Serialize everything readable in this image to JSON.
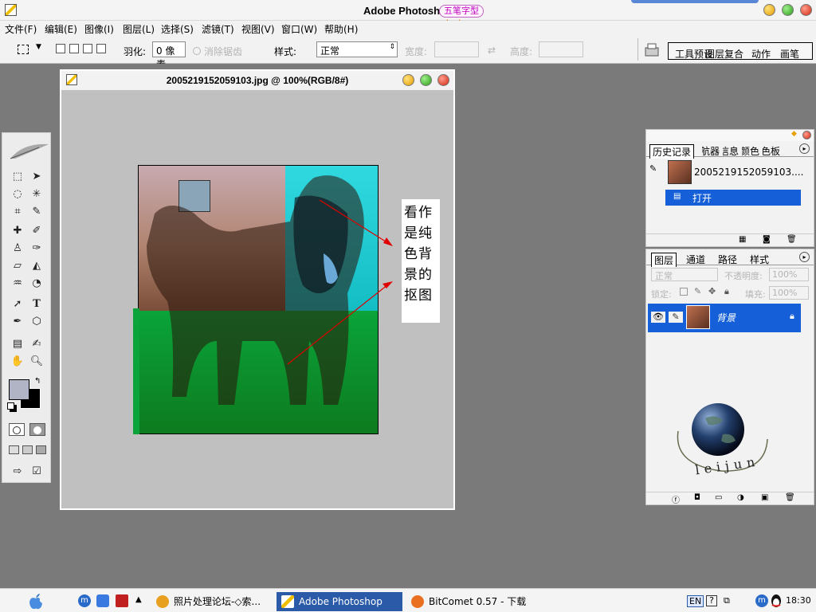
{
  "app": {
    "title": "Adobe Photoshop",
    "ime_badge": "五笔字型"
  },
  "menubar": [
    "文件(F)",
    "编辑(E)",
    "图像(I)",
    "图层(L)",
    "选择(S)",
    "滤镜(T)",
    "视图(V)",
    "窗口(W)",
    "帮助(H)"
  ],
  "options": {
    "feather_label": "羽化:",
    "feather_value": "0 像素",
    "antialias_label": "消除锯齿",
    "style_label": "样式:",
    "style_value": "正常",
    "width_label": "宽度:",
    "height_label": "高度:"
  },
  "palette_well": [
    "工具预设",
    "图层复合",
    "动作",
    "画笔"
  ],
  "document": {
    "title": "2005219152059103.jpg @ 100%(RGB/8#)",
    "annotation": [
      "看作",
      "是纯",
      "色背",
      "景的",
      "抠图"
    ]
  },
  "history_panel": {
    "tabs": [
      "历史记录",
      "导航器",
      "信息",
      "颜色",
      "色板"
    ],
    "snapshot_name": "2005219152059103....",
    "step": "打开"
  },
  "layers_panel": {
    "tabs": [
      "图层",
      "通道",
      "路径",
      "样式"
    ],
    "blend_mode": "正常",
    "opacity_label": "不透明度:",
    "opacity_value": "100%",
    "lock_label": "锁定:",
    "fill_label": "填充:",
    "fill_value": "100%",
    "layer_name": "背景",
    "watermark": "leijun"
  },
  "taskbar": {
    "tasks": [
      "照片处理论坛-◇索...",
      "Adobe Photoshop",
      "BitComet 0.57 - 下载..."
    ],
    "lang": "EN",
    "time": "18:30"
  }
}
